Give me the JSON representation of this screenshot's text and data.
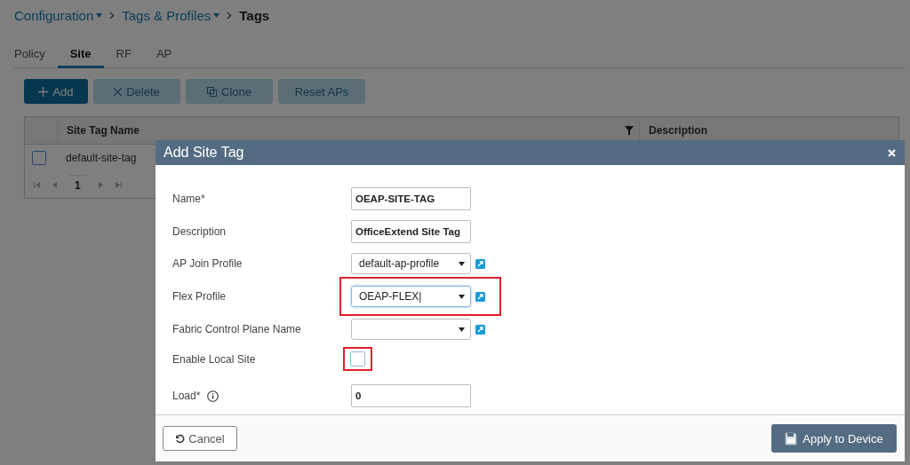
{
  "breadcrumb": [
    {
      "label": "Configuration",
      "dropdown": true,
      "current": false
    },
    {
      "label": "Tags & Profiles",
      "dropdown": true,
      "current": false
    },
    {
      "label": "Tags",
      "dropdown": false,
      "current": true
    }
  ],
  "tabs": [
    {
      "label": "Policy",
      "selected": false
    },
    {
      "label": "Site",
      "selected": true
    },
    {
      "label": "RF",
      "selected": false
    },
    {
      "label": "AP",
      "selected": false
    }
  ],
  "toolbar": [
    {
      "label": "Add",
      "primary": true,
      "disabled": false
    },
    {
      "label": "Delete",
      "primary": false,
      "disabled": true
    },
    {
      "label": "Clone",
      "primary": false,
      "disabled": true
    },
    {
      "label": "Reset APs",
      "primary": false,
      "disabled": true
    }
  ],
  "table": {
    "columns": [
      {
        "label": "Site Tag Name",
        "filter": true
      },
      {
        "label": "Description",
        "filter": false
      }
    ],
    "rows": [
      {
        "cells": [
          "default-site-tag"
        ],
        "checked": false
      }
    ],
    "pagination": {
      "page": "1"
    }
  },
  "dialog": {
    "title": "Add Site Tag",
    "fields": [
      {
        "kind": "text",
        "label": "Name*",
        "value": "OEAP-SITE-TAG",
        "highlighted": false
      },
      {
        "kind": "text",
        "label": "Description",
        "value": "OfficeExtend Site Tag",
        "highlighted": false
      },
      {
        "kind": "select",
        "label": "AP Join Profile",
        "value": "default-ap-profile",
        "highlighted": false,
        "focused": false
      },
      {
        "kind": "select",
        "label": "Flex Profile",
        "value": "OEAP-FLEX|",
        "highlighted": true,
        "focused": true
      },
      {
        "kind": "select",
        "label": "Fabric Control Plane Name",
        "highlighted": false,
        "focused": false
      },
      {
        "kind": "checkbox",
        "label": "Enable Local Site",
        "checked": false,
        "highlighted": true
      },
      {
        "kind": "text",
        "label": "Load*",
        "value": "0",
        "info": true,
        "highlighted": false
      }
    ],
    "cancel": "Cancel",
    "apply": "Apply to Device"
  }
}
